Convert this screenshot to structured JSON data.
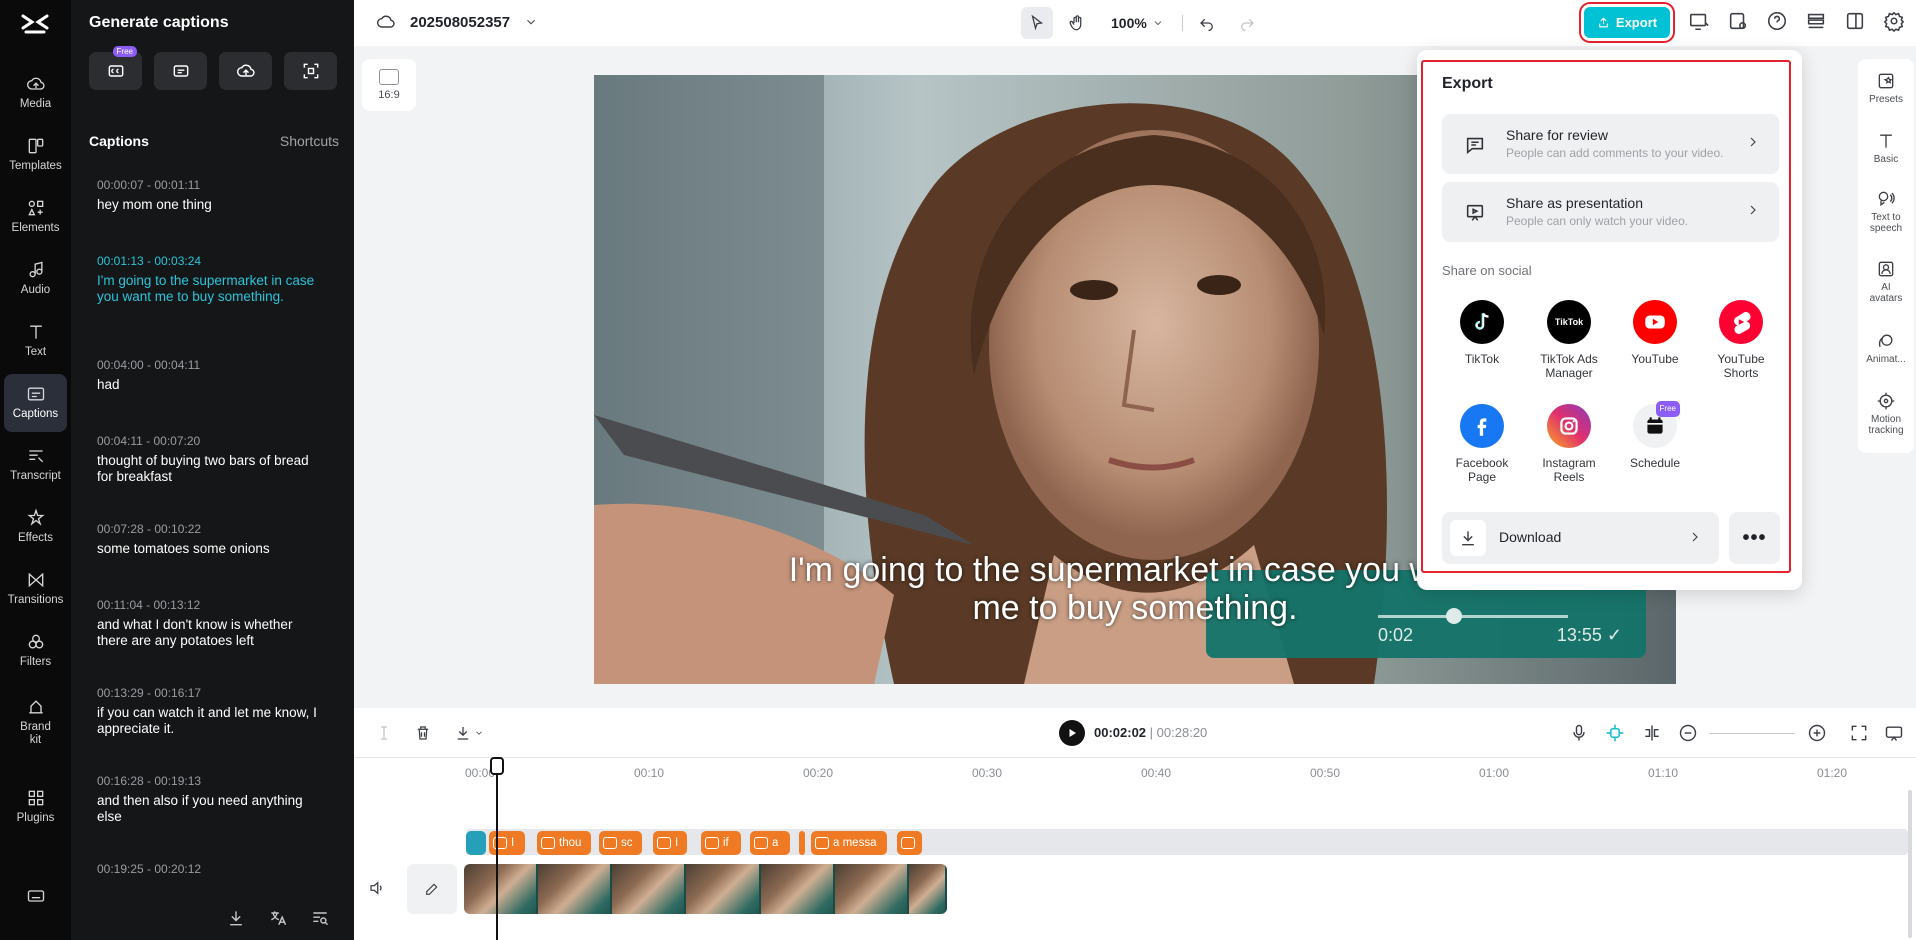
{
  "nav": {
    "items": [
      {
        "label": "Media",
        "icon": "cloud-upload-icon"
      },
      {
        "label": "Templates",
        "icon": "templates-icon"
      },
      {
        "label": "Elements",
        "icon": "elements-icon"
      },
      {
        "label": "Audio",
        "icon": "music-note-icon"
      },
      {
        "label": "Text",
        "icon": "text-icon"
      },
      {
        "label": "Captions",
        "icon": "captions-icon",
        "active": true
      },
      {
        "label": "Transcript",
        "icon": "transcript-icon"
      },
      {
        "label": "Effects",
        "icon": "effects-icon"
      },
      {
        "label": "Transitions",
        "icon": "transitions-icon"
      },
      {
        "label": "Filters",
        "icon": "filters-icon"
      },
      {
        "label": "Brand kit",
        "icon": "brand-kit-icon"
      },
      {
        "label": "Plugins",
        "icon": "plugins-icon"
      }
    ]
  },
  "panel": {
    "title": "Generate captions",
    "free_badge": "Free",
    "captions_label": "Captions",
    "shortcuts_label": "Shortcuts",
    "captions": [
      {
        "time": "00:00:07 - 00:01:11",
        "text": "hey mom one thing"
      },
      {
        "time": "00:01:13 - 00:03:24",
        "text": "I'm going to the supermarket in case you want me to buy something.",
        "active": true
      },
      {
        "time": "00:04:00 - 00:04:11",
        "text": "had"
      },
      {
        "time": "00:04:11 - 00:07:20",
        "text": "thought of buying two bars of bread for breakfast"
      },
      {
        "time": "00:07:28 - 00:10:22",
        "text": "some tomatoes some onions"
      },
      {
        "time": "00:11:04 - 00:13:12",
        "text": "and what I don't know is whether there are any potatoes left"
      },
      {
        "time": "00:13:29 - 00:16:17",
        "text": "if you can watch it and let me know, I appreciate it."
      },
      {
        "time": "00:16:28 - 00:19:13",
        "text": "and then also if you need anything else"
      },
      {
        "time": "00:19:25 - 00:20:12",
        "text": ""
      }
    ]
  },
  "topbar": {
    "project_name": "202508052357",
    "zoom": "100%",
    "export_label": "Export"
  },
  "canvas": {
    "ratio_label": "16:9",
    "subtitle": "I'm going to the supermarket in case you want\nme to buy something.",
    "wa_time_left": "0:02",
    "wa_time_right": "13:55 ✓"
  },
  "right_panel": [
    {
      "label": "Presets"
    },
    {
      "label": "Basic"
    },
    {
      "label": "Text to speech"
    },
    {
      "label": "AI avatars"
    },
    {
      "label": "Animat..."
    },
    {
      "label": "Motion tracking"
    }
  ],
  "export": {
    "title": "Export",
    "share_review": {
      "title": "Share for review",
      "desc": "People can add comments to your video."
    },
    "share_presentation": {
      "title": "Share as presentation",
      "desc": "People can only watch your video."
    },
    "share_social_label": "Share on social",
    "social": [
      {
        "label": "TikTok",
        "color": "#000000"
      },
      {
        "label": "TikTok Ads Manager",
        "color": "#000000"
      },
      {
        "label": "YouTube",
        "color": "#ff0000"
      },
      {
        "label": "YouTube Shorts",
        "color": "#ff0033"
      },
      {
        "label": "Facebook Page",
        "color": "#1877f2"
      },
      {
        "label": "Instagram Reels",
        "color": "#d6249f"
      },
      {
        "label": "Schedule",
        "color": "#f0f1f3",
        "badge": "Free"
      }
    ],
    "download_label": "Download"
  },
  "timeline": {
    "current_time": "00:02:02",
    "total_time": "00:28:20",
    "ruler": [
      "00:00",
      "00:10",
      "00:20",
      "00:30",
      "00:40",
      "00:50",
      "01:00",
      "01:10",
      "01:20"
    ],
    "chips": [
      "I",
      "thou",
      "sc",
      "I",
      "if",
      "a",
      "a messa",
      ""
    ]
  }
}
